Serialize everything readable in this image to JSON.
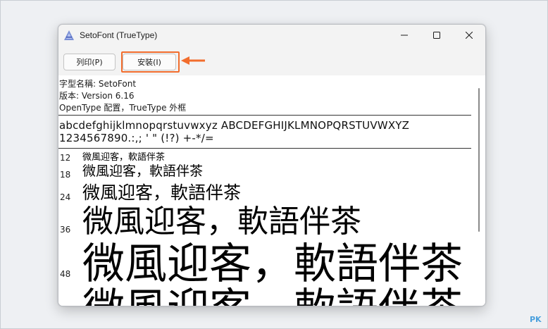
{
  "window": {
    "title": "SetoFont (TrueType)",
    "icon": "font-app-icon"
  },
  "toolbar": {
    "print_label": "列印(P)",
    "install_label": "安裝(I)"
  },
  "font_info": {
    "name_line": "字型名稱: SetoFont",
    "version_line": "版本: Version 6.16",
    "type_line": "OpenType 配置，TrueType 外框"
  },
  "samples": {
    "alphabet": "abcdefghijklmnopqrstuvwxyz ABCDEFGHIJKLMNOPQRSTUVWXYZ",
    "digits": "1234567890.:,; ' \" (!?) +-*/="
  },
  "previews": [
    {
      "size": "12",
      "text": "微風迎客，軟語伴茶"
    },
    {
      "size": "18",
      "text": "微風迎客，軟語伴茶"
    },
    {
      "size": "24",
      "text": "微風迎客，軟語伴茶"
    },
    {
      "size": "36",
      "text": "微風迎客，軟語伴茶"
    },
    {
      "size": "48",
      "text": "微風迎客，軟語伴茶"
    },
    {
      "size": "",
      "text": "微風迎客，軟語伴茶"
    }
  ],
  "annotation": {
    "highlight_color": "#f26d2d"
  },
  "watermark": "PK"
}
